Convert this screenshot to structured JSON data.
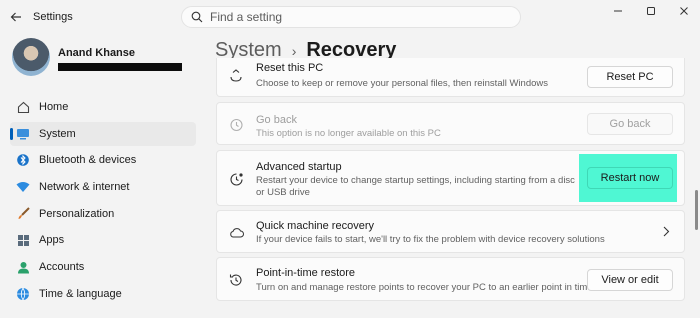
{
  "app": {
    "title": "Settings"
  },
  "search": {
    "placeholder": "Find a setting"
  },
  "user": {
    "name": "Anand Khanse"
  },
  "sidebar": {
    "items": [
      {
        "label": "Home",
        "icon": "home-icon"
      },
      {
        "label": "System",
        "icon": "system-icon",
        "active": true
      },
      {
        "label": "Bluetooth & devices",
        "icon": "bluetooth-icon"
      },
      {
        "label": "Network & internet",
        "icon": "wifi-icon"
      },
      {
        "label": "Personalization",
        "icon": "brush-icon"
      },
      {
        "label": "Apps",
        "icon": "apps-icon"
      },
      {
        "label": "Accounts",
        "icon": "person-icon"
      },
      {
        "label": "Time & language",
        "icon": "globe-clock-icon"
      }
    ]
  },
  "breadcrumb": {
    "parent": "System",
    "current": "Recovery"
  },
  "cards": {
    "reset": {
      "title": "Reset this PC",
      "desc": "Choose to keep or remove your personal files, then reinstall Windows",
      "button": "Reset PC"
    },
    "goback": {
      "title": "Go back",
      "desc": "This option is no longer available on this PC",
      "button": "Go back"
    },
    "advanced": {
      "title": "Advanced startup",
      "desc": "Restart your device to change startup settings, including starting from a disc or USB drive",
      "button": "Restart now"
    },
    "quick": {
      "title": "Quick machine recovery",
      "desc": "If your device fails to start, we'll try to fix the problem with device recovery solutions"
    },
    "pit": {
      "title": "Point-in-time restore",
      "desc": "Turn on and manage restore points to recover your PC to an earlier point in time",
      "button": "View or edit"
    }
  },
  "colors": {
    "accent": "#005fb8",
    "highlight": "#4ff7d3"
  }
}
